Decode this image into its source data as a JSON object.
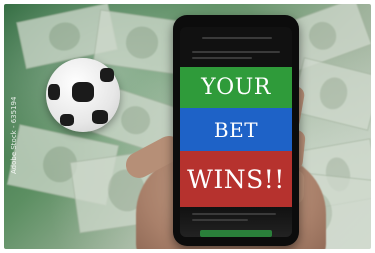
{
  "screen": {
    "line1": "YOUR",
    "line2": "BET",
    "line3": "WINS!!"
  },
  "watermark": "Adobe Stock - 635194",
  "colors": {
    "green_band": "#2f9b3a",
    "blue_band": "#1e62c7",
    "red_band": "#b6322e"
  }
}
